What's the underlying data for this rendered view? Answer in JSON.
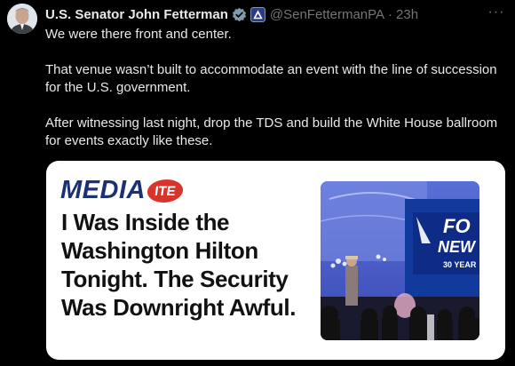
{
  "author": {
    "name": "U.S. Senator John Fetterman",
    "handle": "@SenFettermanPA",
    "separator": "·",
    "time": "23h",
    "verified_icon": "government-verified-badge-icon",
    "affiliation_icon": "blue-triangle-affiliation-icon"
  },
  "menu": {
    "more_icon": "more-options-icon",
    "more_glyph": "···"
  },
  "tweet": {
    "paragraphs": [
      "We were there front and center.",
      "That venue wasn’t built to accommodate an event with the line of succession for the U.S. government.",
      "After witnessing last night, drop the TDS and build the White House ballroom for events exactly like these."
    ]
  },
  "card": {
    "logo_main": "MEDIA",
    "logo_badge": "ITE",
    "headline": "I Was Inside the Washington Hilton Tonight. The Security Was Downright Awful.",
    "photo": {
      "screen_text_1": "FO",
      "screen_text_2": "NEW",
      "screen_text_3": "30 YEAR"
    }
  },
  "colors": {
    "background": "#000000",
    "text": "#e7e9ea",
    "muted": "#71767b",
    "verified": "#829aab",
    "mediaite_blue": "#1b3272",
    "mediaite_red": "#d9342b"
  }
}
